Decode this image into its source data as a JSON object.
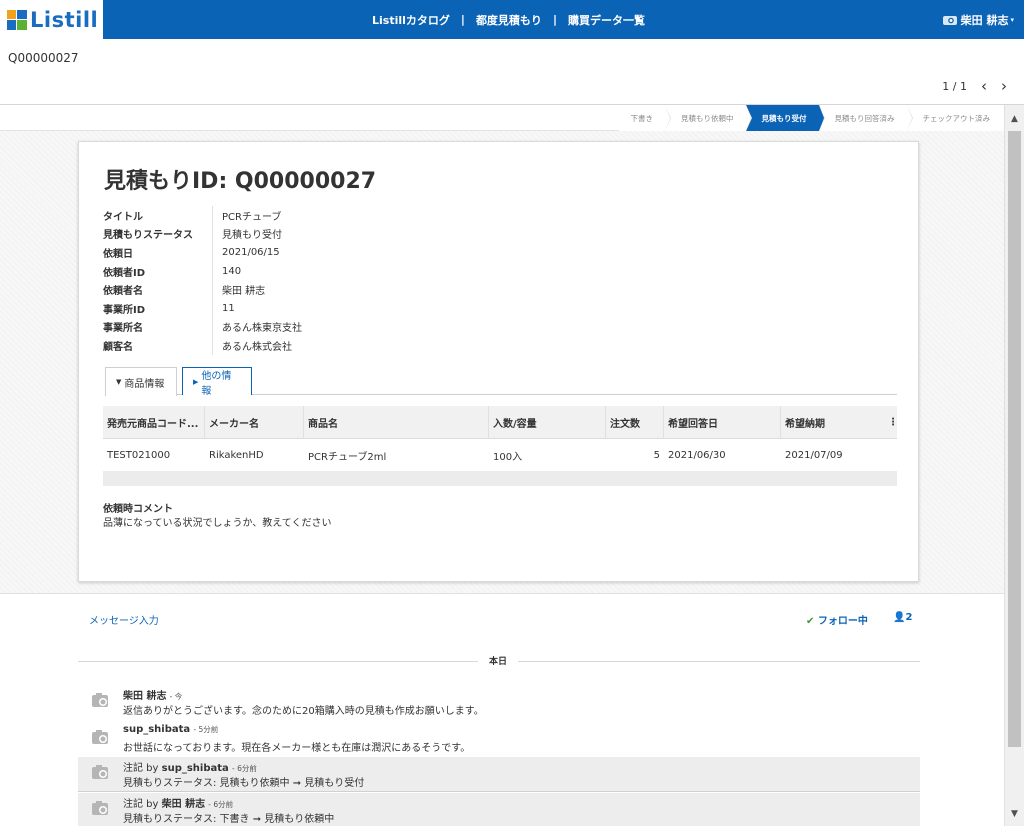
{
  "header": {
    "logo_text": "Listill",
    "nav": [
      "Listillカタログ",
      "都度見積もり",
      "購買データ一覧"
    ],
    "nav_separator": "|",
    "user": "柴田 耕志",
    "brand_color": "#0b63b6"
  },
  "record_id": "Q00000027",
  "pager": {
    "text": "1 / 1",
    "prev": "‹",
    "next": "›"
  },
  "status_path": [
    {
      "label": "下書き",
      "active": false
    },
    {
      "label": "見積もり依頼中",
      "active": false
    },
    {
      "label": "見積もり受付",
      "active": true
    },
    {
      "label": "見積もり回答済み",
      "active": false
    },
    {
      "label": "チェックアウト済み",
      "active": false
    }
  ],
  "card": {
    "title": "見積もりID: Q00000027",
    "fields": [
      {
        "label": "タイトル",
        "value": "PCRチューブ"
      },
      {
        "label": "見積もりステータス",
        "value": "見積もり受付"
      },
      {
        "label": "依頼日",
        "value": "2021/06/15"
      },
      {
        "label": "依頼者ID",
        "value": "140"
      },
      {
        "label": "依頼者名",
        "value": "柴田 耕志"
      },
      {
        "label": "事業所ID",
        "value": "11"
      },
      {
        "label": "事業所名",
        "value": "あるん株東京支社"
      },
      {
        "label": "顧客名",
        "value": "あるん株式会社"
      }
    ],
    "tabs": {
      "active": "商品情報",
      "other": "他の情報"
    },
    "table": {
      "headers": [
        "発売元商品コード...",
        "メーカー名",
        "商品名",
        "入数/容量",
        "注文数",
        "希望回答日",
        "希望納期"
      ],
      "rows": [
        [
          "TEST021000",
          "RikakenHD",
          "PCRチューブ2ml",
          "100入",
          "5",
          "2021/06/30",
          "2021/07/09"
        ]
      ]
    },
    "comment_label": "依頼時コメント",
    "comment_text": "品薄になっている状況でしょうか、教えてください"
  },
  "messages": {
    "input_label": "メッセージ入力",
    "follow_label": "フォロー中",
    "followers_count": "2",
    "date_label": "本日",
    "items": [
      {
        "prefix": "",
        "author": "柴田 耕志",
        "time": "- 今",
        "body": "返信ありがとうございます。念のために20箱購入時の見積も作成お願いします。",
        "note": false
      },
      {
        "prefix": "",
        "author": "sup_shibata",
        "time": "- 5分前",
        "body": "お世話になっております。現在各メーカー様とも在庫は潤沢にあるそうです。",
        "note": false
      },
      {
        "prefix": "注記 by ",
        "author": "sup_shibata",
        "time": "- 6分前",
        "body": "見積もりステータス: 見積もり依頼中 ➞ 見積もり受付",
        "note": true
      },
      {
        "prefix": "注記 by ",
        "author": "柴田 耕志",
        "time": "- 6分前",
        "body": "見積もりステータス: 下書き ➞ 見積もり依頼中",
        "note": true
      }
    ]
  }
}
